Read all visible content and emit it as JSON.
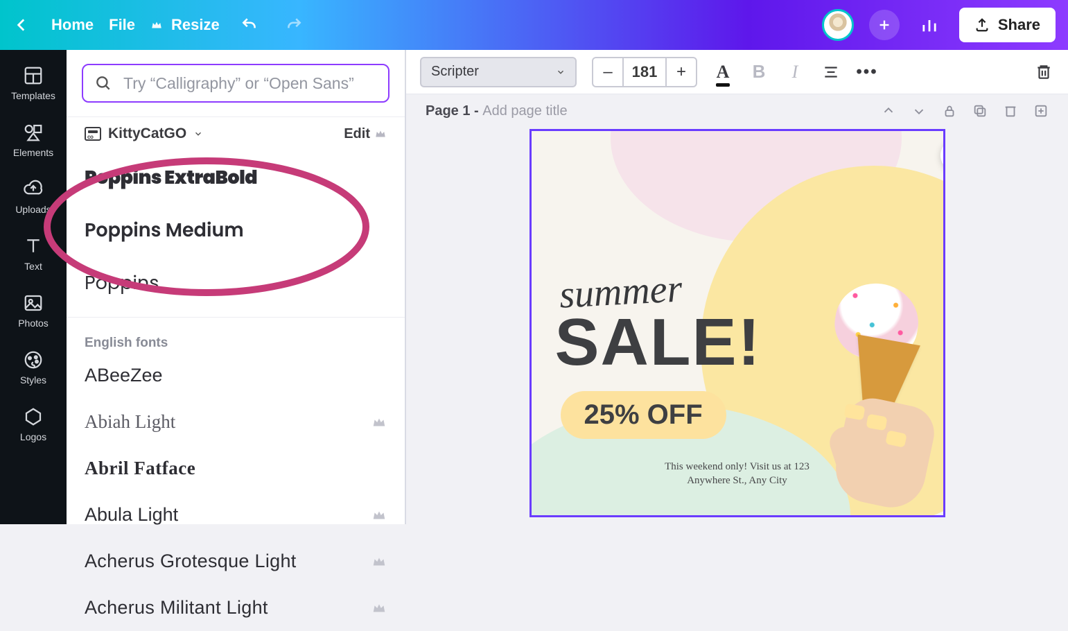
{
  "topbar": {
    "home": "Home",
    "file": "File",
    "resize": "Resize",
    "share": "Share"
  },
  "rail": {
    "templates": "Templates",
    "elements": "Elements",
    "uploads": "Uploads",
    "text": "Text",
    "photos": "Photos",
    "styles": "Styles",
    "logos": "Logos"
  },
  "fontPanel": {
    "search_placeholder": "Try “Calligraphy” or “Open Sans”",
    "brand_name": "KittyCatGO",
    "edit": "Edit",
    "brand_fonts": [
      {
        "label": "Poppins ExtraBold",
        "cls": "f-poppins-xb"
      },
      {
        "label": "Poppins Medium",
        "cls": "f-poppins-md"
      },
      {
        "label": "Poppins",
        "cls": "f-poppins"
      }
    ],
    "section_label": "English fonts",
    "fonts": [
      {
        "label": "ABeeZee",
        "cls": "f-abee",
        "premium": false
      },
      {
        "label": "Abiah Light",
        "cls": "f-abiah",
        "premium": true
      },
      {
        "label": "Abril Fatface",
        "cls": "f-abril",
        "premium": false
      },
      {
        "label": "Abula Light",
        "cls": "f-abula",
        "premium": true
      },
      {
        "label": "Acherus Grotesque Light",
        "cls": "f-acherus",
        "premium": true
      },
      {
        "label": "Acherus Militant Light",
        "cls": "f-acherus",
        "premium": true
      }
    ]
  },
  "propbar": {
    "font_name": "Scripter",
    "font_size": "181",
    "minus": "–",
    "plus": "+",
    "letter": "A",
    "bold": "B",
    "italic": "I",
    "more": "•••"
  },
  "page": {
    "label_strong": "Page 1 - ",
    "label_muted": "Add page title"
  },
  "design": {
    "summer": "summer",
    "sale": "SALE!",
    "off": "25% OFF",
    "caption1": "This weekend only! Visit us at 123",
    "caption2": "Anywhere St., Any City"
  }
}
